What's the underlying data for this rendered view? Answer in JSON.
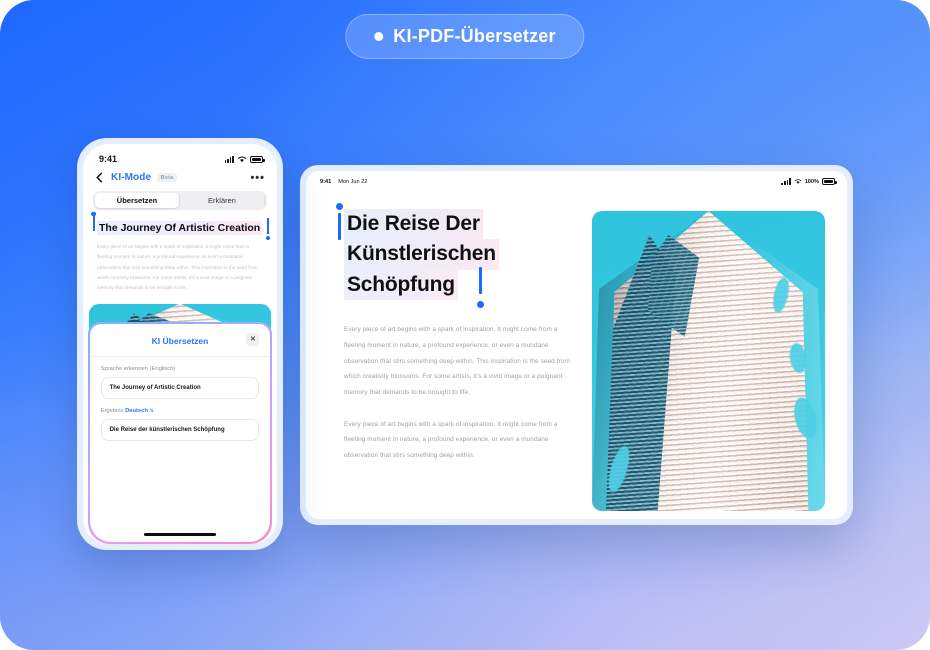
{
  "badge": {
    "label": "KI-PDF-Übersetzer",
    "dot_icon": "dot-icon"
  },
  "colors": {
    "brand_blue": "#2d74f7",
    "selection_blue": "#1a6afd",
    "bg_start": "#1f68fd",
    "bg_end": "#cfccf4",
    "sky_cyan": "#2ec3de",
    "modal_border_start": "#7fb1ff",
    "modal_border_end": "#ff86c9"
  },
  "phone": {
    "status": {
      "time": "9:41",
      "signal_icon": "cellular-bars-icon",
      "wifi_icon": "wifi-icon",
      "battery_icon": "battery-icon"
    },
    "nav": {
      "back_icon": "chevron-left-icon",
      "title": "KI-Mode",
      "badge": "Beta",
      "more_icon": "more-options-icon",
      "more_label": "•••"
    },
    "segments": [
      {
        "label": "Übersetzen",
        "active": true
      },
      {
        "label": "Erklären",
        "active": false
      }
    ],
    "article": {
      "heading": "The Journey Of Artistic Creation",
      "paragraph": "Every piece of art begins with a spark of inspiration. It might come from a fleeting moment in nature, a profound experience, or even a mundane observation that stirs something deep within. This inspiration is the seed from which creativity blossoms. For some artists, it's a vivid image or a poignant memory that demands to be brought to life.",
      "image_alt": "wavy-tower-architecture-photo"
    },
    "modal": {
      "title": "KI Übersetzen",
      "close_icon": "close-icon",
      "close_label": "✕",
      "source_label": "Sprache erkennen (Englisch)",
      "source_text": "The Journey of Artistic Creation",
      "result_label": "Ergebnis",
      "result_language": "Deutsch",
      "caret_icon": "chevron-updown-icon",
      "caret_label": "⇅",
      "result_text": "Die Reise der künstlerischen Schöpfung"
    },
    "home_indicator": "home-indicator"
  },
  "tablet": {
    "status": {
      "time": "9:41",
      "date": "Mon Jun 22",
      "signal_icon": "cellular-bars-icon",
      "wifi_icon": "wifi-icon",
      "battery_percent": "100%",
      "battery_icon": "battery-icon"
    },
    "article": {
      "heading_lines": [
        "Die Reise Der",
        "Künstlerischen",
        "Schöpfung"
      ],
      "paragraphs": [
        "Every piece of art begins with a spark of inspiration. It might come from a fleeting moment in nature, a profound experience, or even a mundane observation that stirs something deep within. This inspiration is the seed from which creativity blossoms. For some artists, it's a vivid image or a poignant memory that demands to be brought to life.",
        "Every piece of art begins with a spark of inspiration. It might come from a fleeting moment in nature, a profound experience, or even a mundane observation that stirs something deep within."
      ],
      "image_alt": "wavy-tower-architecture-photo"
    }
  }
}
